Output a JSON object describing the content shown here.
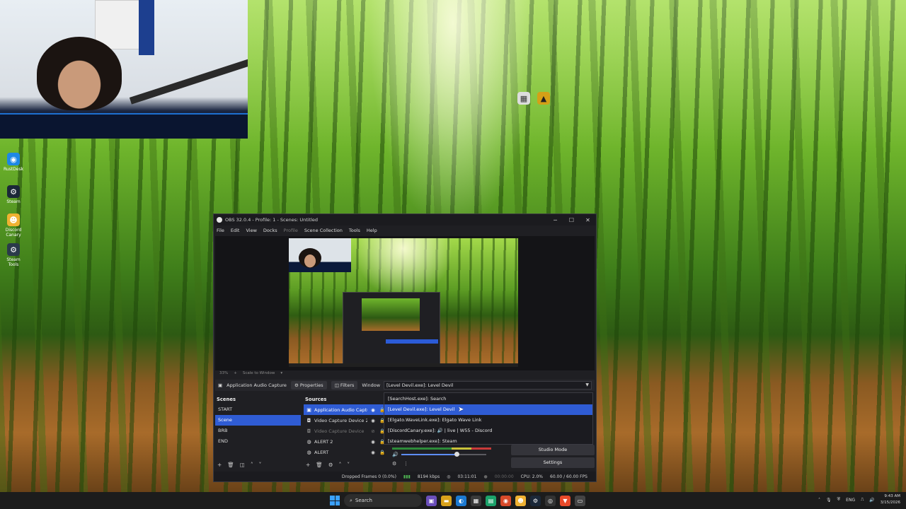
{
  "obs": {
    "title": "OBS 32.0.4 - Profile: 1 - Scenes: Untitled",
    "menu": [
      "File",
      "Edit",
      "View",
      "Docks",
      "Profile",
      "Scene Collection",
      "Tools",
      "Help"
    ],
    "zoom_label": "33%",
    "scale_label": "Scale to Window",
    "toolbar": {
      "source_name": "Application Audio Capture",
      "properties": "Properties",
      "filters": "Filters",
      "window_label": "Window",
      "window_value": "[Level Devil.exe]: Level Devil"
    },
    "scenes": {
      "header": "Scenes",
      "items": [
        "START",
        "Scene",
        "BRB",
        "END"
      ]
    },
    "sources": {
      "header": "Sources",
      "items": [
        "Application Audio Captu",
        "Video Capture Device 2",
        "Video Capture Device",
        "ALERT 2",
        "ALERT"
      ]
    },
    "mixer": {
      "scale": "-60 -55 -50 -45 -40 -35 -30 -25 -20 -15 -10 -5 0",
      "volume_level": 0.65
    },
    "controls": {
      "studio_mode": "Studio Mode",
      "settings": "Settings"
    },
    "statusbar": {
      "dropped": "Dropped Frames 0 (0.0%)",
      "bitrate": "8194 kbps",
      "rec_time": "03:11:01",
      "stream_time": "00:00:00",
      "cpu": "CPU: 2.0%",
      "fps": "60.00 / 60.00 FPS"
    }
  },
  "dropdown": {
    "items": [
      "[SearchHost.exe]: Search",
      "[Level Devil.exe]: Level Devil",
      "[Elgato.WaveLink.exe]: Elgato Wave Link",
      "[DiscordCanary.exe]: 🔊 | live | W55 - Discord",
      "[steamwebhelper.exe]: Steam"
    ],
    "selected_index": 1
  },
  "desktop_icons": [
    "RustDesk",
    "Steam",
    "Discord Canary",
    "Steam Tools"
  ],
  "taskbar": {
    "search": "Search",
    "lang": "ENG",
    "time": "9:43 AM",
    "date": "3/15/2026"
  }
}
